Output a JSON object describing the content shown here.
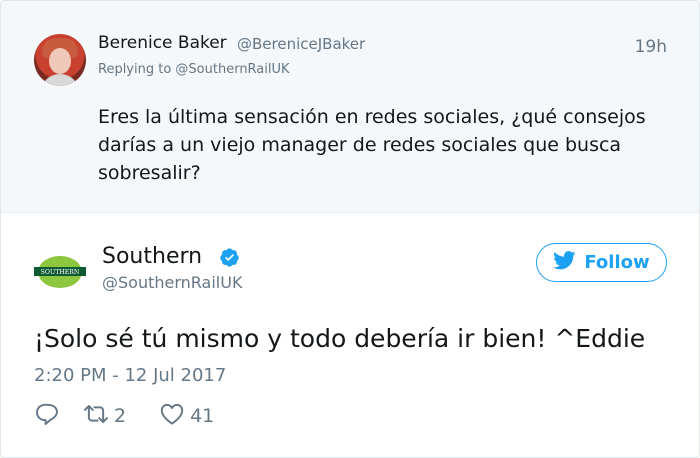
{
  "reply_tweet": {
    "author_name": "Berenice Baker",
    "author_handle": "@BereniceJBaker",
    "timestamp": "19h",
    "replying_to": "Replying to @SouthernRailUK",
    "text": "Eres la última sensación en redes sociales, ¿qué consejos darías a un viejo manager de redes sociales que busca sobresalir?"
  },
  "main_tweet": {
    "author_name": "Southern",
    "author_handle": "@SouthernRailUK",
    "follow_label": "Follow",
    "logo_text": "SOUTHERN",
    "text": "¡Solo sé tú mismo y todo debería ir bien! ^Eddie",
    "timestamp": "2:20 PM - 12 Jul 2017",
    "retweet_count": "2",
    "like_count": "41"
  },
  "colors": {
    "accent": "#1da1f2",
    "muted_text": "#657786",
    "reply_background": "#f5f8fa",
    "logo_green": "#8dc63f",
    "logo_dark": "#0f5a32"
  },
  "icons": [
    "verified-badge-icon",
    "twitter-bird-icon",
    "reply-icon",
    "retweet-icon",
    "like-heart-icon"
  ]
}
